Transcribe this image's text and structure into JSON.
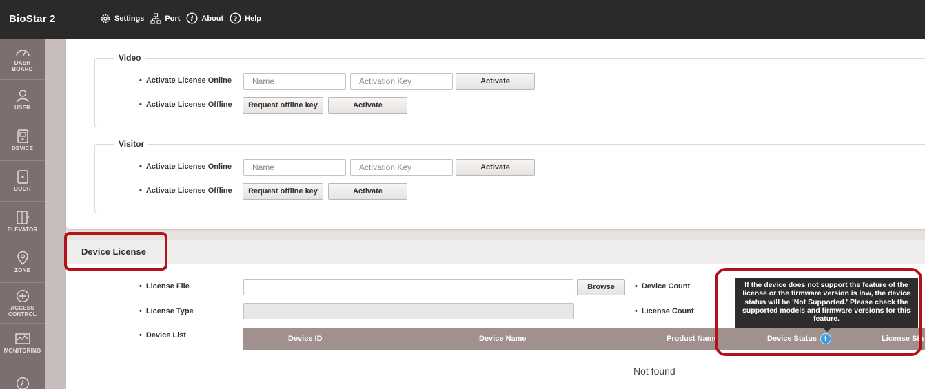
{
  "app": {
    "brand": "BioStar 2"
  },
  "topnav": [
    {
      "label": "Settings",
      "icon": "gear-icon"
    },
    {
      "label": "Port",
      "icon": "network-icon"
    },
    {
      "label": "About",
      "icon": "info-icon"
    },
    {
      "label": "Help",
      "icon": "help-icon"
    }
  ],
  "sidebar": {
    "items": [
      {
        "label_line1": "DASH",
        "label_line2": "BOARD",
        "icon": "dashboard-icon"
      },
      {
        "label_line1": "USER",
        "label_line2": "",
        "icon": "user-icon"
      },
      {
        "label_line1": "DEVICE",
        "label_line2": "",
        "icon": "device-icon"
      },
      {
        "label_line1": "DOOR",
        "label_line2": "",
        "icon": "door-icon"
      },
      {
        "label_line1": "ELEVATOR",
        "label_line2": "",
        "icon": "elevator-icon"
      },
      {
        "label_line1": "ZONE",
        "label_line2": "",
        "icon": "zone-icon"
      },
      {
        "label_line1": "ACCESS",
        "label_line2": "CONTROL",
        "icon": "access-control-icon"
      },
      {
        "label_line1": "MONITORING",
        "label_line2": "",
        "icon": "monitoring-icon"
      },
      {
        "label_line1": "",
        "label_line2": "",
        "icon": "time-icon"
      }
    ]
  },
  "video": {
    "title": "Video",
    "online_label": "Activate License Online",
    "offline_label": "Activate License Offline",
    "name_placeholder": "Name",
    "key_placeholder": "Activation Key",
    "activate_label": "Activate",
    "request_label": "Request offline key",
    "offline_activate_label": "Activate"
  },
  "visitor": {
    "title": "Visitor",
    "online_label": "Activate License Online",
    "offline_label": "Activate License Offline",
    "name_placeholder": "Name",
    "key_placeholder": "Activation Key",
    "activate_label": "Activate",
    "request_label": "Request offline key",
    "offline_activate_label": "Activate"
  },
  "device_license": {
    "title": "Device License",
    "license_file_label": "License File",
    "browse_label": "Browse",
    "device_count_label": "Device Count",
    "license_type_label": "License Type",
    "license_count_label": "License Count",
    "device_list_label": "Device List",
    "columns": [
      "Device ID",
      "Device Name",
      "Product Name",
      "Device Status",
      "License Sta"
    ],
    "empty_text": "Not found",
    "tooltip": "If the device does not support the feature of the license or the firmware version is low, the device status will be 'Not Supported.' Please check the supported models and firmware versions for this feature.",
    "info_glyph": "i"
  },
  "colors": {
    "highlight": "#b3121b",
    "topbar": "#2b2a29",
    "sidebar": "#7d6f6f",
    "table_header": "#a0918f",
    "info": "#3d9de0"
  }
}
